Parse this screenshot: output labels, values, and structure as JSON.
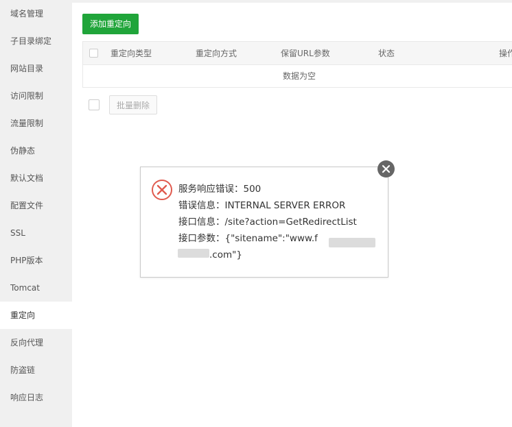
{
  "sidebar": {
    "items": [
      {
        "label": "域名管理"
      },
      {
        "label": "子目录绑定"
      },
      {
        "label": "网站目录"
      },
      {
        "label": "访问限制"
      },
      {
        "label": "流量限制"
      },
      {
        "label": "伪静态"
      },
      {
        "label": "默认文档"
      },
      {
        "label": "配置文件"
      },
      {
        "label": "SSL"
      },
      {
        "label": "PHP版本"
      },
      {
        "label": "Tomcat"
      },
      {
        "label": "重定向",
        "active": true
      },
      {
        "label": "反向代理"
      },
      {
        "label": "防盗链"
      },
      {
        "label": "响应日志"
      }
    ]
  },
  "toolbar": {
    "add_label": "添加重定向"
  },
  "table": {
    "headers": [
      "重定向类型",
      "重定向方式",
      "保留URL参数",
      "状态",
      "操作"
    ],
    "empty_text": "数据为空"
  },
  "footer": {
    "batch_delete_label": "批量删除"
  },
  "dialog": {
    "line1": "服务响应错误：500",
    "line2": "错误信息：INTERNAL SERVER ERROR",
    "line3": "接口信息：/site?action=GetRedirectList",
    "line4": "接口参数：{\"sitename\":\"www.f",
    "line5": ".com\"}"
  },
  "colors": {
    "accent": "#20a53a",
    "error": "#e05a4e",
    "sidebar_bg": "#f0f0f0",
    "close_bg": "#666666"
  },
  "icons": {
    "error": "error-x-icon",
    "close": "close-icon"
  }
}
